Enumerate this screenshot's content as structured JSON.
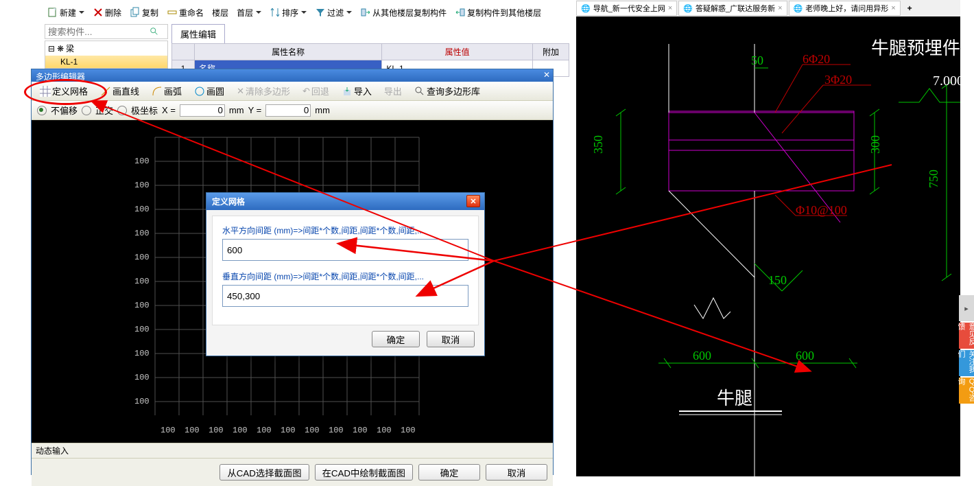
{
  "toolbar": {
    "new": "新建",
    "delete": "删除",
    "copy": "复制",
    "rename": "重命名",
    "floor": "楼层",
    "first_floor": "首层",
    "sort": "排序",
    "filter": "过滤",
    "copy_from": "从其他楼层复制构件",
    "copy_to": "复制构件到其他楼层"
  },
  "search": {
    "placeholder": "搜索构件..."
  },
  "tree": {
    "root": "梁",
    "child": "KL-1"
  },
  "attr": {
    "tab": "属性编辑",
    "col_name": "属性名称",
    "col_value": "属性值",
    "col_extra": "附加",
    "row1": "1",
    "name_label": "名称",
    "name_value": "KL-1"
  },
  "polygon": {
    "title": "多边形编辑器",
    "define_grid": "定义网格",
    "draw_line": "画直线",
    "draw_arc": "画弧",
    "draw_circle": "画圆",
    "clear": "清除多边形",
    "undo": "回退",
    "import": "导入",
    "export": "导出",
    "query": "查询多边形库",
    "no_offset": "不偏移",
    "ortho": "正交",
    "polar": "极坐标",
    "x_label": "X =",
    "y_label": "Y =",
    "unit": "mm",
    "x_val": "0",
    "y_val": "0",
    "grid_val": "100",
    "footer": "动态输入",
    "btn_cad_select": "从CAD选择截面图",
    "btn_cad_draw": "在CAD中绘制截面图",
    "btn_ok": "确定",
    "btn_cancel": "取消"
  },
  "grid_dialog": {
    "title": "定义网格",
    "h_label": "水平方向间距 (mm)=>间距*个数,间距,间距*个数,间距,...",
    "h_value": "600",
    "v_label": "垂直方向间距 (mm)=>间距*个数,间距,间距*个数,间距,...",
    "v_value": "450,300",
    "ok": "确定",
    "cancel": "取消"
  },
  "tabs": {
    "t1": "导航_新一代安全上网",
    "t2": "答疑解惑_广联达服务新",
    "t3": "老师晚上好，请问用异形"
  },
  "cad": {
    "title": "牛腿预埋件",
    "rebar1": "6Φ20",
    "rebar2": "3Φ20",
    "elev": "7.000",
    "stirrup": "Φ10@100",
    "dim50": "50",
    "dim350": "350",
    "dim300": "300",
    "dim750": "750",
    "dim150": "150",
    "dim600a": "600",
    "dim600b": "600",
    "label2": "牛腿"
  },
  "badges": {
    "b1": "意见反馈",
    "b2": "关注我们",
    "b3": "QQ咨询"
  }
}
